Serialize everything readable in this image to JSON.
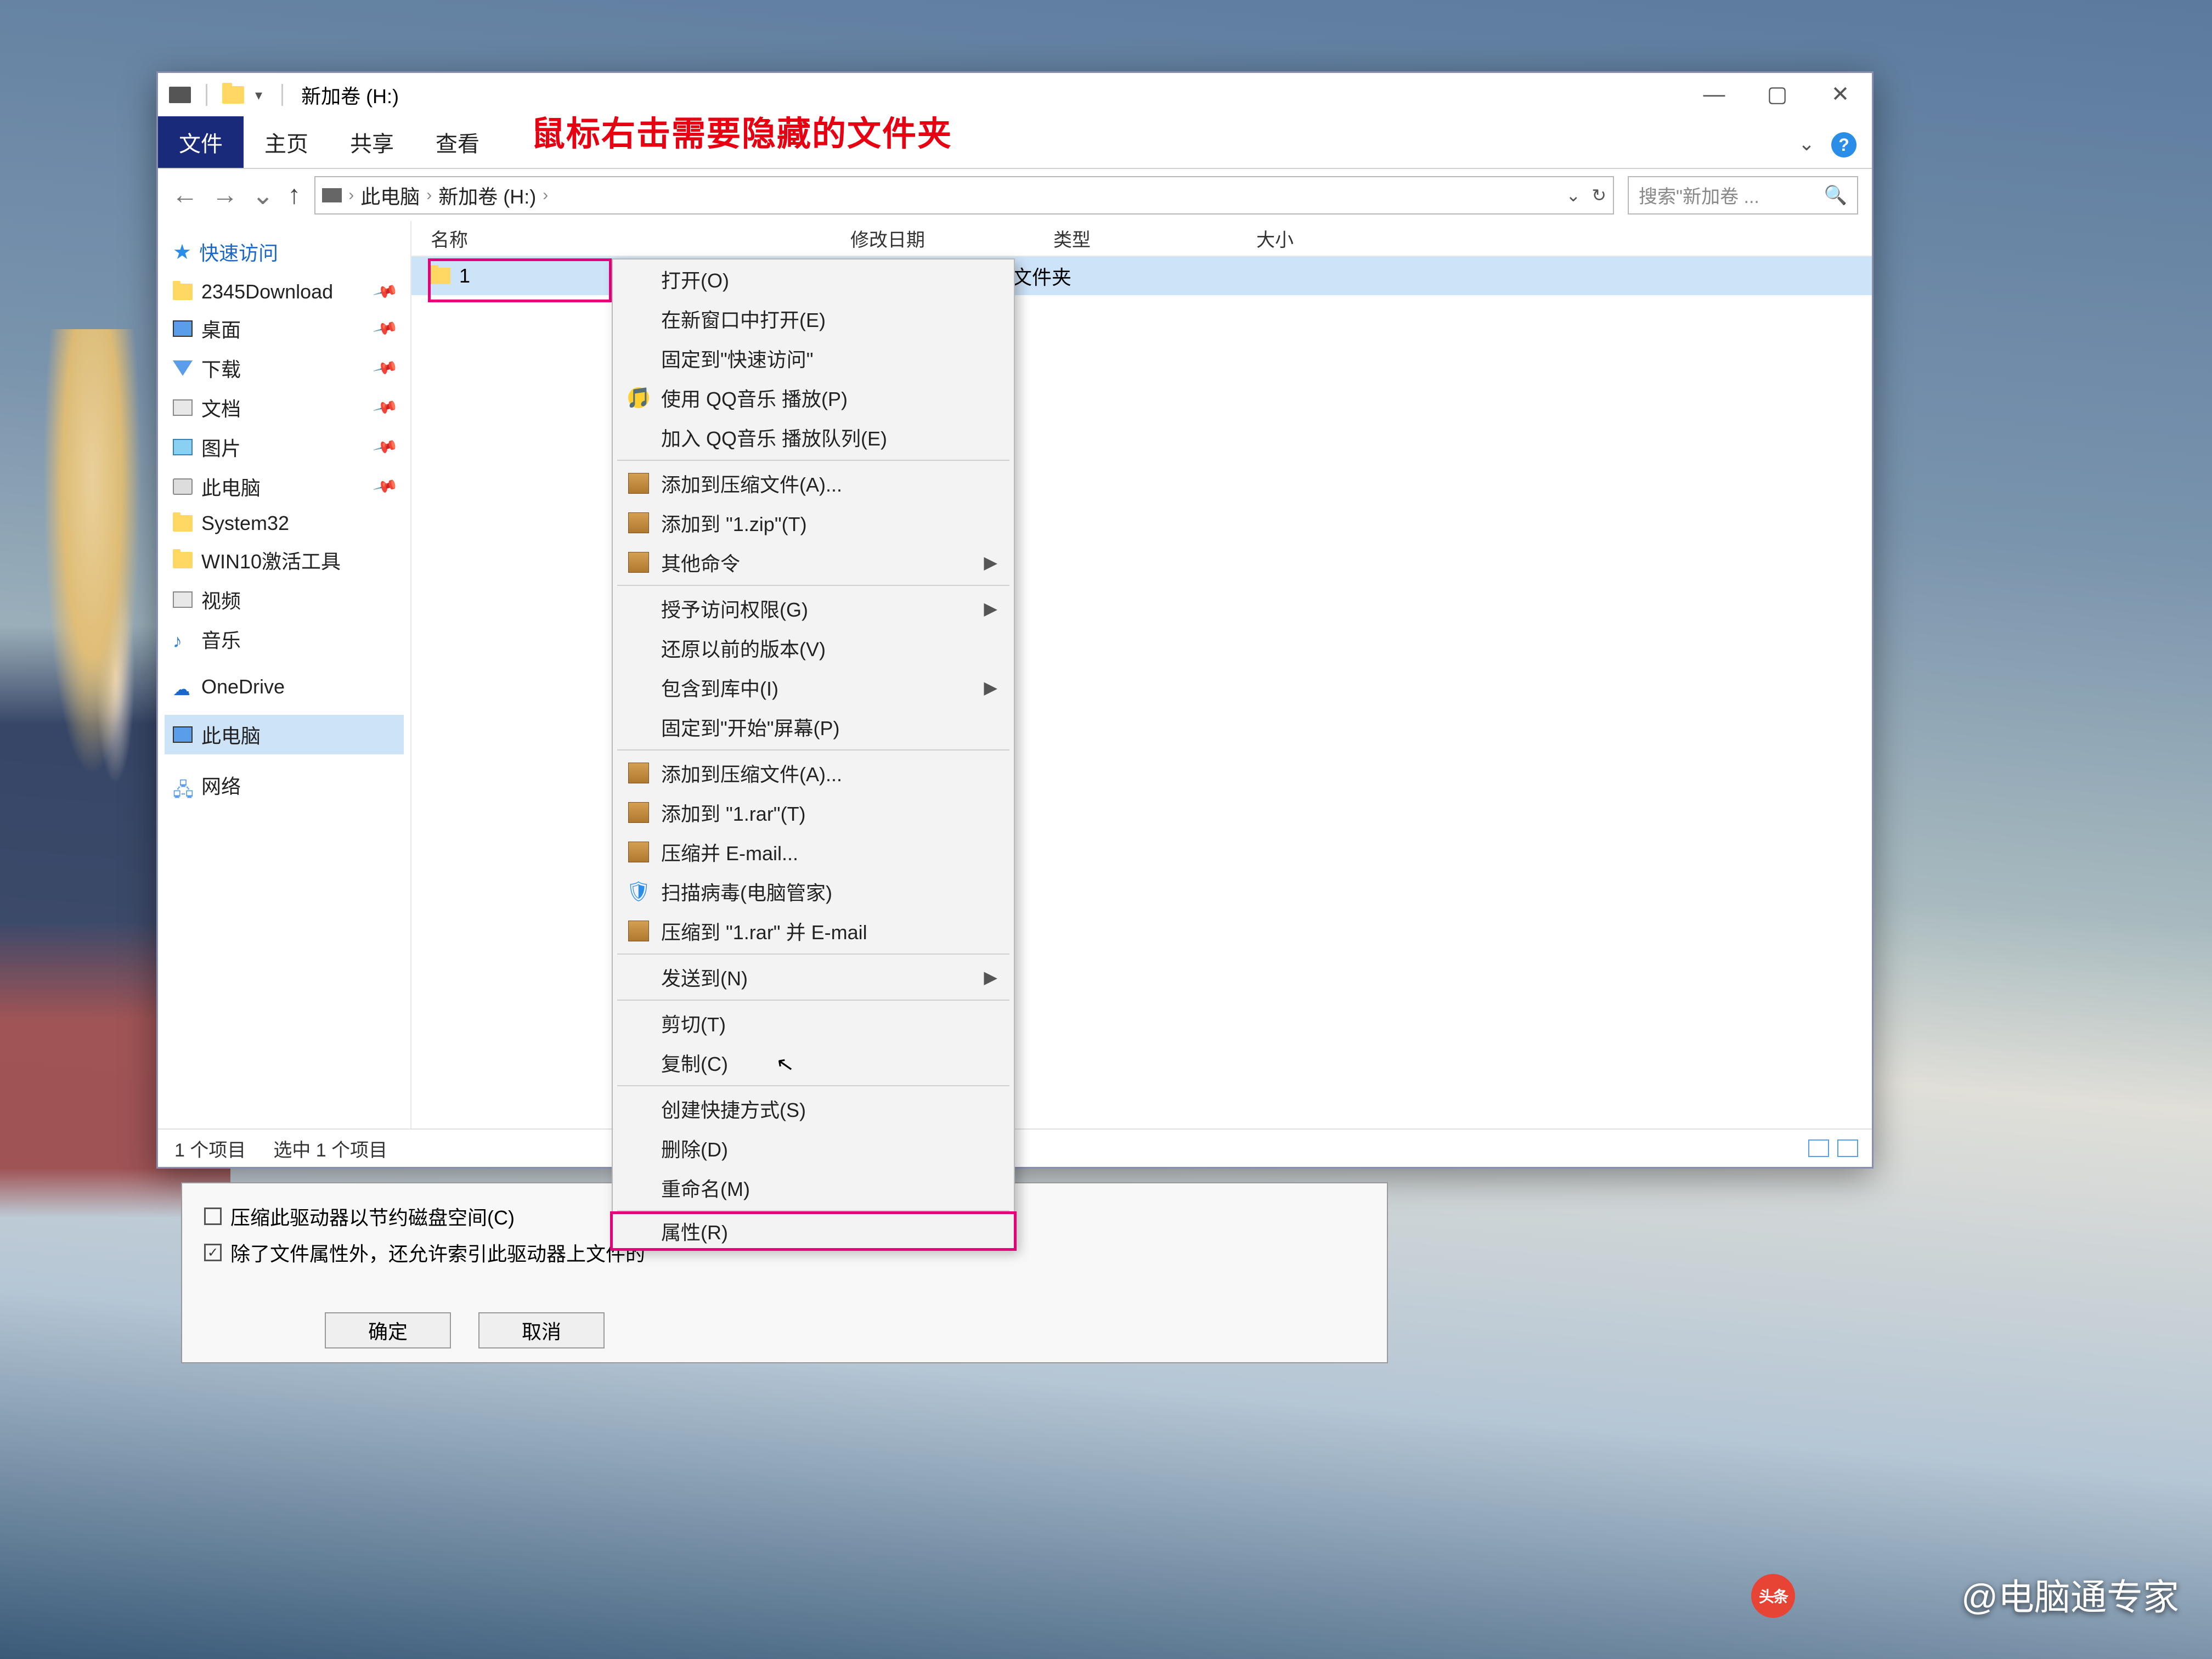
{
  "annotation": "鼠标右击需要隐藏的文件夹",
  "window": {
    "title": "新加卷 (H:)",
    "controls": {
      "minimize": "—",
      "maximize": "▢",
      "close": "✕"
    }
  },
  "ribbon": {
    "file": "文件",
    "tabs": [
      "主页",
      "共享",
      "查看"
    ],
    "expand": "⌄"
  },
  "nav": {
    "back": "←",
    "fwd": "→",
    "up": "↑",
    "breadcrumb": [
      "此电脑",
      "新加卷 (H:)"
    ],
    "refresh": "↻",
    "search_placeholder": "搜索\"新加卷 ..."
  },
  "sidebar": {
    "quick": "快速访问",
    "quick_items": [
      {
        "label": "2345Download",
        "icon": "folder",
        "pin": true
      },
      {
        "label": "桌面",
        "icon": "monitor",
        "pin": true
      },
      {
        "label": "下载",
        "icon": "downarrow",
        "pin": true
      },
      {
        "label": "文档",
        "icon": "doc",
        "pin": true
      },
      {
        "label": "图片",
        "icon": "pic",
        "pin": true
      },
      {
        "label": "此电脑",
        "icon": "drive",
        "pin": true
      },
      {
        "label": "System32",
        "icon": "folder",
        "pin": false
      },
      {
        "label": "WIN10激活工具",
        "icon": "folder",
        "pin": false
      },
      {
        "label": "视频",
        "icon": "vid",
        "pin": false
      },
      {
        "label": "音乐",
        "icon": "music",
        "pin": false
      }
    ],
    "onedrive": "OneDrive",
    "thispc": "此电脑",
    "network": "网络"
  },
  "columns": {
    "name": "名称",
    "date": "修改日期",
    "type": "类型",
    "size": "大小"
  },
  "file": {
    "name": "1",
    "type": "文件夹"
  },
  "context_menu": {
    "groups": [
      [
        "打开(O)",
        "在新窗口中打开(E)",
        "固定到\"快速访问\"",
        "使用 QQ音乐 播放(P)",
        "加入 QQ音乐 播放队列(E)"
      ],
      [
        "添加到压缩文件(A)...",
        "添加到 \"1.zip\"(T)",
        "其他命令"
      ],
      [
        "授予访问权限(G)",
        "还原以前的版本(V)",
        "包含到库中(I)",
        "固定到\"开始\"屏幕(P)"
      ],
      [
        "添加到压缩文件(A)...",
        "添加到 \"1.rar\"(T)",
        "压缩并 E-mail...",
        "扫描病毒(电脑管家)",
        "压缩到 \"1.rar\" 并 E-mail"
      ],
      [
        "发送到(N)"
      ],
      [
        "剪切(T)",
        "复制(C)"
      ],
      [
        "创建快捷方式(S)",
        "删除(D)",
        "重命名(M)"
      ],
      [
        "属性(R)"
      ]
    ],
    "arrows": [
      "其他命令",
      "授予访问权限(G)",
      "包含到库中(I)",
      "发送到(N)"
    ],
    "icons": {
      "使用 QQ音乐 播放(P)": "qq",
      "添加到压缩文件(A)...": "archive",
      "添加到 \"1.zip\"(T)": "archive",
      "其他命令": "archive",
      "添加到 \"1.rar\"(T)": "archive",
      "压缩并 E-mail...": "archive",
      "扫描病毒(电脑管家)": "shield",
      "压缩到 \"1.rar\" 并 E-mail": "archive"
    }
  },
  "status": {
    "items": "1 个项目",
    "selected": "选中 1 个项目"
  },
  "dialog": {
    "chk1": "压缩此驱动器以节约磁盘空间(C)",
    "chk2": "除了文件属性外，还允许索引此驱动器上文件的",
    "ok": "确定",
    "cancel": "取消"
  },
  "watermark": {
    "brand": "头条",
    "author": "@电脑通专家"
  }
}
